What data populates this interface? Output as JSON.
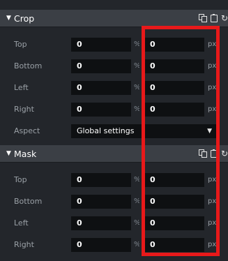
{
  "crop": {
    "title": "Crop",
    "rows": [
      {
        "label": "Top",
        "value1": "0",
        "unit1": "%",
        "value2": "0",
        "unit2": "px"
      },
      {
        "label": "Bottom",
        "value1": "0",
        "unit1": "%",
        "value2": "0",
        "unit2": "px"
      },
      {
        "label": "Left",
        "value1": "0",
        "unit1": "%",
        "value2": "0",
        "unit2": "px"
      },
      {
        "label": "Right",
        "value1": "0",
        "unit1": "%",
        "value2": "0",
        "unit2": "px"
      }
    ],
    "aspect": {
      "label": "Aspect",
      "value": "Global settings",
      "arrow": "▼"
    }
  },
  "mask": {
    "title": "Mask",
    "rows": [
      {
        "label": "Top",
        "value1": "0",
        "unit1": "%",
        "value2": "0",
        "unit2": "px"
      },
      {
        "label": "Bottom",
        "value1": "0",
        "unit1": "%",
        "value2": "0",
        "unit2": "px"
      },
      {
        "label": "Left",
        "value1": "0",
        "unit1": "%",
        "value2": "0",
        "unit2": "px"
      },
      {
        "label": "Right",
        "value1": "0",
        "unit1": "%",
        "value2": "0",
        "unit2": "px"
      }
    ]
  },
  "icons": {
    "collapse": "▼",
    "copy": "copy-icon",
    "paste": "paste-icon",
    "reset": "↻"
  },
  "colors": {
    "highlight": "#e8191a",
    "panel_bg": "#23262b",
    "header_bg": "#3b3f45",
    "field_bg": "#0e1012"
  }
}
